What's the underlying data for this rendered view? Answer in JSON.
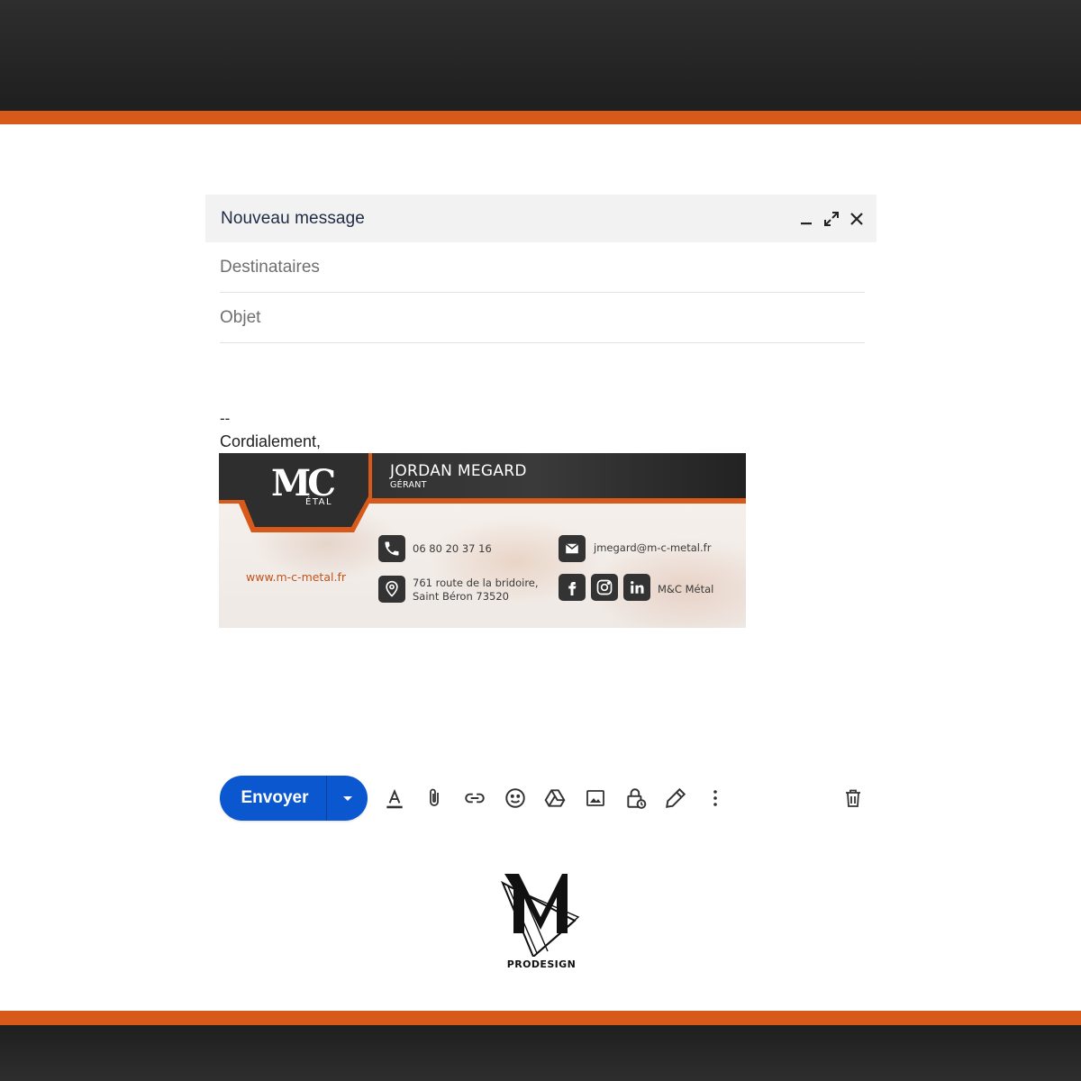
{
  "compose": {
    "title": "Nouveau message",
    "recipients_placeholder": "Destinataires",
    "subject_placeholder": "Objet"
  },
  "body": {
    "signature_separator": "--",
    "greeting": "Cordialement,"
  },
  "signature": {
    "logo_text": "MC",
    "logo_subtext": "ÉTAL",
    "name": "JORDAN MEGARD",
    "role": "GÉRANT",
    "website": "www.m-c-metal.fr",
    "phone": "06 80 20 37 16",
    "address_line1": "761 route de la bridoire,",
    "address_line2": "Saint Béron 73520",
    "email": "jmegard@m-c-metal.fr",
    "social_name": "M&C Métal",
    "icons": [
      "phone-icon",
      "location-icon",
      "mail-icon",
      "facebook-icon",
      "instagram-icon",
      "linkedin-icon"
    ]
  },
  "toolbar": {
    "send_label": "Envoyer",
    "tools": [
      "text-format-icon",
      "attach-icon",
      "link-icon",
      "emoji-icon",
      "drive-icon",
      "photo-icon",
      "confidential-icon",
      "signature-icon",
      "more-options-icon"
    ],
    "discard": "trash-icon"
  },
  "branding": {
    "name": "PRODESIGN"
  },
  "colors": {
    "accent_orange": "#d85a1a",
    "dark_band": "#262626",
    "send_blue": "#0b57d0",
    "header_gray": "#f2f2f2"
  }
}
